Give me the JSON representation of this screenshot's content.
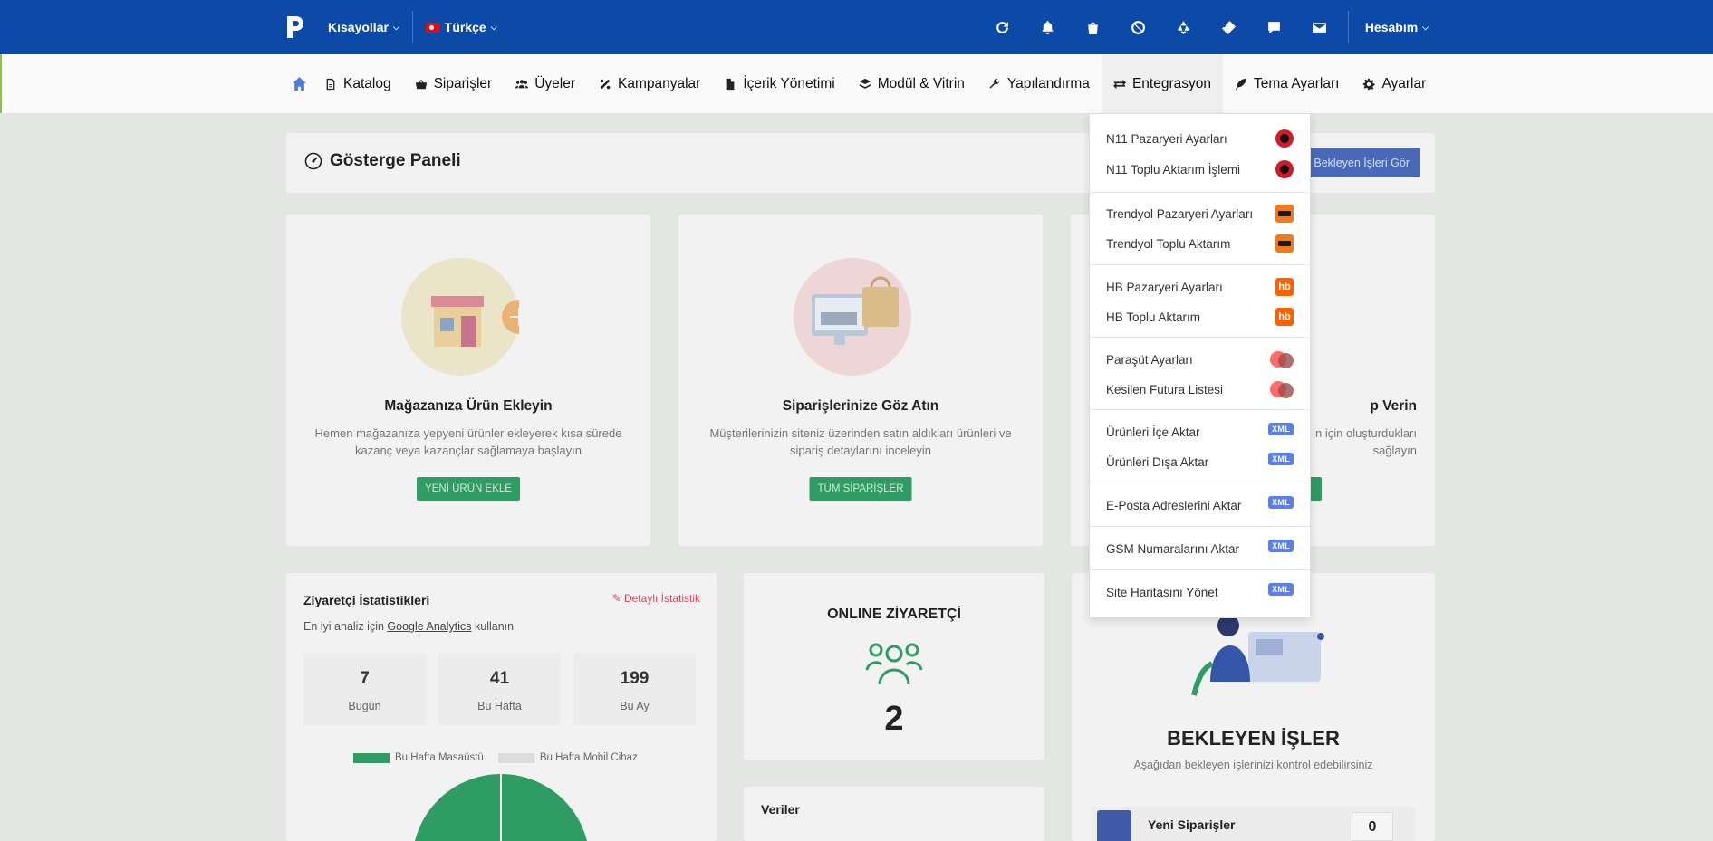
{
  "topbar": {
    "shortcuts": "Kısayollar",
    "language": "Türkçe",
    "account": "Hesabım",
    "icons": [
      "refresh-icon",
      "bell-icon",
      "shopping-bag-icon",
      "ban-icon",
      "recycle-icon",
      "ticket-icon",
      "comment-icon",
      "envelope-icon"
    ]
  },
  "nav": {
    "items": [
      {
        "label": "Katalog",
        "icon": "file-pdf-icon"
      },
      {
        "label": "Siparişler",
        "icon": "basket-icon"
      },
      {
        "label": "Üyeler",
        "icon": "users-icon"
      },
      {
        "label": "Kampanyalar",
        "icon": "percent-icon"
      },
      {
        "label": "İçerik Yönetimi",
        "icon": "file-icon"
      },
      {
        "label": "Modül & Vitrin",
        "icon": "layers-icon"
      },
      {
        "label": "Yapılandırma",
        "icon": "wrench-icon"
      },
      {
        "label": "Entegrasyon",
        "icon": "exchange-icon"
      },
      {
        "label": "Tema Ayarları",
        "icon": "feather-icon"
      },
      {
        "label": "Ayarlar",
        "icon": "gear-icon"
      }
    ]
  },
  "dropdown": {
    "items": [
      {
        "label": "N11 Pazaryeri Ayarları",
        "badge": "n11"
      },
      {
        "label": "N11 Toplu Aktarım İşlemi",
        "badge": "n11"
      },
      {
        "label": "Trendyol Pazaryeri Ayarları",
        "badge": "trendyol"
      },
      {
        "label": "Trendyol Toplu Aktarım",
        "badge": "trendyol"
      },
      {
        "label": "HB Pazaryeri Ayarları",
        "badge": "hb"
      },
      {
        "label": "HB Toplu Aktarım",
        "badge": "hb"
      },
      {
        "label": "Paraşüt Ayarları",
        "badge": "parasut"
      },
      {
        "label": "Kesilen Futura Listesi",
        "badge": "parasut"
      },
      {
        "label": "Ürünleri İçe Aktar",
        "badge": "xml"
      },
      {
        "label": "Ürünleri Dışa Aktar",
        "badge": "xml"
      },
      {
        "label": "E-Posta Adreslerini Aktar",
        "badge": "xml"
      },
      {
        "label": "GSM Numaralarını Aktar",
        "badge": "xml"
      },
      {
        "label": "Site Haritasını Yönet",
        "badge": "xml"
      }
    ],
    "hb_text": "hb",
    "xml_text": "XML"
  },
  "dashboard": {
    "title": "Gösterge Paneli",
    "pending_button": "Bekleyen İşleri Gör",
    "features": [
      {
        "title": "Mağazanıza Ürün Ekleyin",
        "text": "Hemen mağazanıza yepyeni ürünler ekleyerek kısa sürede kazanç veya kazançlar sağlamaya başlayın",
        "button": "YENİ ÜRÜN EKLE"
      },
      {
        "title": "Siparişlerinize Göz Atın",
        "text": "Müşterilerinizin siteniz üzerinden satın aldıkları ürünleri ve sipariş detaylarını inceleyin",
        "button": "TÜM SİPARİŞLER"
      },
      {
        "title": "p Verin",
        "text": "n için oluşturdukları sağlayın",
        "button": ""
      }
    ],
    "stats": {
      "title": "Ziyaretçi İstatistikleri",
      "detail_link": "Detaylı İstatistik",
      "sub_prefix": "En iyi analiz için",
      "sub_link": "Google Analytics",
      "sub_suffix": "kullanın",
      "boxes": [
        {
          "value": "7",
          "label": "Bugün"
        },
        {
          "value": "41",
          "label": "Bu Hafta"
        },
        {
          "value": "199",
          "label": "Bu Ay"
        }
      ],
      "legend_desktop": "Bu Hafta Masaüstü",
      "legend_mobile": "Bu Hafta Mobil Cihaz"
    },
    "online": {
      "title": "ONLINE ZİYARETÇİ",
      "count": "2"
    },
    "veriler": "Veriler",
    "pending": {
      "title": "BEKLEYEN İŞLER",
      "text": "Aşağıdan bekleyen işlerinizi kontrol edebilirsiniz",
      "row_label": "Yeni Siparişler",
      "row_count": "0"
    }
  },
  "colors": {
    "topbar": "#0d4aa8",
    "accent_green": "#2f9c63",
    "xml_badge": "#5b7fe3"
  }
}
